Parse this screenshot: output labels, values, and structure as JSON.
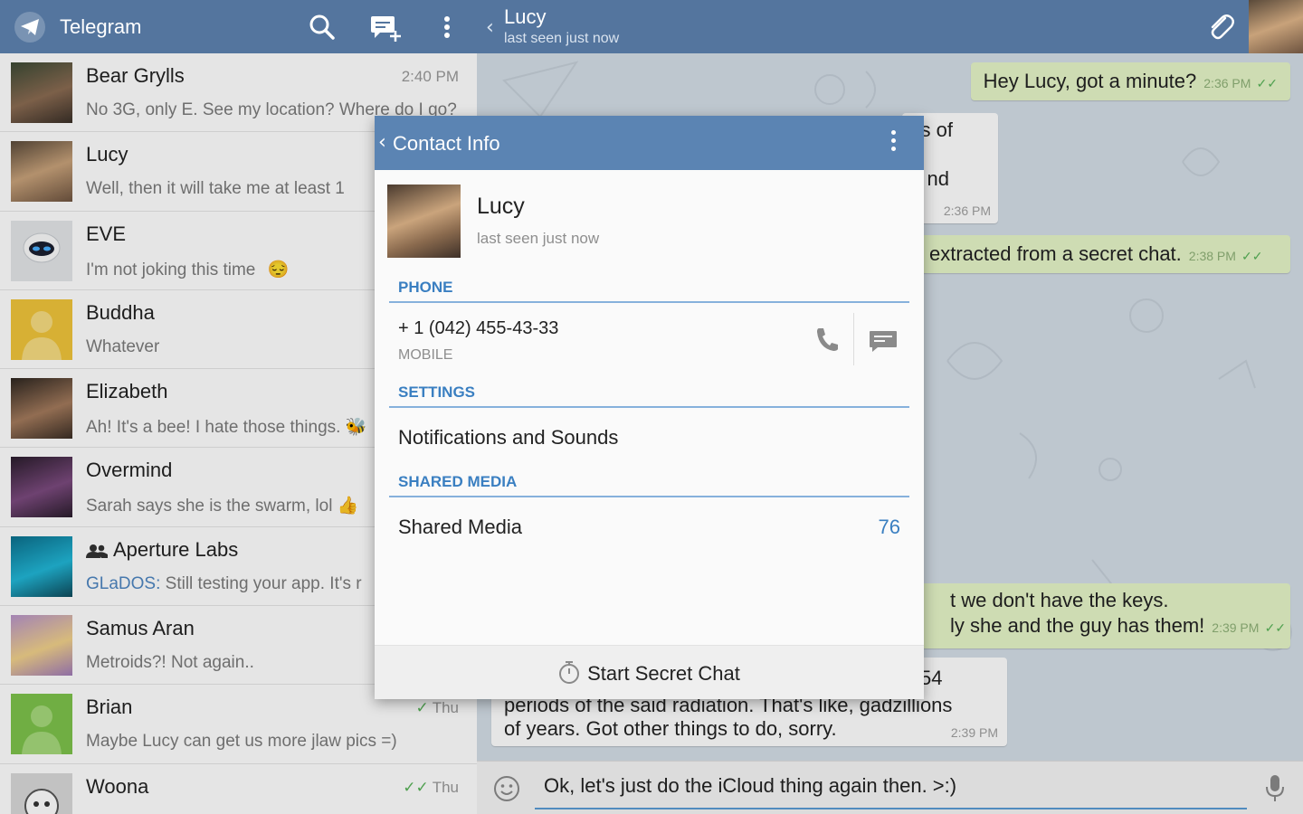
{
  "app": {
    "title": "Telegram"
  },
  "chats": [
    {
      "name": "Bear Grylls",
      "time": "2:40 PM",
      "preview": "No 3G, only E. See my location? Where do I go?",
      "avatar_color": "#6b5a48"
    },
    {
      "name": "Lucy",
      "time": "",
      "preview": "Well, then it will take me at least 1",
      "avatar_color": "#9a7350"
    },
    {
      "name": "EVE",
      "time": "",
      "preview": "I'm not joking this time",
      "emoji": "😔",
      "avatar_color": "#d8dde3"
    },
    {
      "name": "Buddha",
      "time": "",
      "preview": "Whatever",
      "avatar_color": "#f0c43a"
    },
    {
      "name": "Elizabeth",
      "time": "",
      "preview": "Ah! It's a bee! I hate those things.",
      "emoji": "🐝",
      "avatar_color": "#4d4036"
    },
    {
      "name": "Overmind",
      "time": "",
      "preview": "Sarah says she is the swarm, lol",
      "emoji": "👍",
      "avatar_color": "#6b3a6e"
    },
    {
      "name": "Aperture Labs",
      "time": "",
      "sender": "GLaDOS:",
      "preview": "Still testing your app. It's r",
      "group": true,
      "avatar_color": "#1ea3c4"
    },
    {
      "name": "Samus Aran",
      "time": "",
      "preview": "Metroids?! Not again..",
      "avatar_color": "#c7a6d6"
    },
    {
      "name": "Brian",
      "time": "Thu",
      "check": "✓",
      "preview": "Maybe Lucy can get us more jlaw pics =)",
      "avatar_color": "#7dc24b"
    },
    {
      "name": "Woona",
      "time": "Thu",
      "check": "✓✓",
      "preview": "",
      "avatar_color": "#cfcfcf"
    }
  ],
  "conversation": {
    "name": "Lucy",
    "status": "last seen just now",
    "messages": [
      {
        "dir": "out",
        "text": "Hey Lucy, got a minute?",
        "time": "2:36 PM",
        "read": "✓✓"
      },
      {
        "dir": "in",
        "text": "s of",
        "time": ""
      },
      {
        "dir": "in",
        "text": "nd",
        "time": "2:36 PM"
      },
      {
        "dir": "out",
        "text": "extracted from a secret chat.",
        "time": "2:38 PM",
        "read": "✓✓"
      },
      {
        "dir": "out",
        "text": "t we don't have the keys.",
        "time": ""
      },
      {
        "dir": "out",
        "text": "ly she and the guy has them!",
        "time": "2:39 PM",
        "read": "✓✓"
      },
      {
        "dir": "in",
        "text": "54",
        "time": ""
      },
      {
        "dir": "in",
        "text": "periods of the said radiation. That's like, gadzillions",
        "time": ""
      },
      {
        "dir": "in",
        "text": "of years. Got other things to do, sorry.",
        "time": "2:39 PM"
      }
    ],
    "input_value": "Ok, let's just do the iCloud thing again then. >:)"
  },
  "contact_info": {
    "title": "Contact Info",
    "name": "Lucy",
    "status": "last seen just now",
    "phone_header": "PHONE",
    "phone_number": "+ 1 (042) 455-43-33",
    "phone_type": "MOBILE",
    "settings_header": "SETTINGS",
    "notifications_label": "Notifications and Sounds",
    "shared_media_header": "SHARED MEDIA",
    "shared_media_label": "Shared Media",
    "shared_media_count": "76",
    "secret_chat_label": "Start Secret Chat"
  },
  "colors": {
    "header": "#54759e",
    "dialog_header": "#5b84b3",
    "accent": "#3a7fc1",
    "outgoing_bubble": "#e6f5c8",
    "check_green": "#58b359"
  },
  "icons": [
    "telegram-logo-icon",
    "search-icon",
    "new-message-icon",
    "more-vert-icon",
    "back-chevron-icon",
    "attach-icon",
    "call-icon",
    "message-icon",
    "smiley-icon",
    "mic-icon",
    "timer-icon",
    "group-icon"
  ]
}
